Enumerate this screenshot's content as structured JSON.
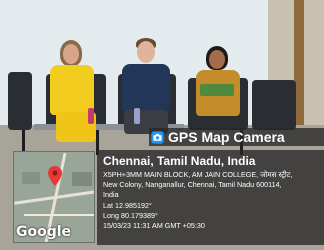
{
  "camera_badge": {
    "title": "GPS Map Camera",
    "icon": "camera-icon"
  },
  "location": {
    "city": "Chennai, Tamil Nadu, India",
    "address_line1": "X5PH+3MM MAIN BLOCK, AM JAIN COLLEGE, जोमस स्ट्रीट,",
    "address_line2": "New Colony, Nanganallur, Chennai, Tamil Nadu 600114,",
    "address_line3": "India",
    "lat": "Lat 12.985192°",
    "long": "Long 80.179389°",
    "timestamp": "15/03/23 11:31 AM GMT +05:30"
  },
  "map": {
    "brand": "Google",
    "pin_icon": "map-pin-icon"
  },
  "colors": {
    "panel": "#262626",
    "pin": "#e53935"
  }
}
